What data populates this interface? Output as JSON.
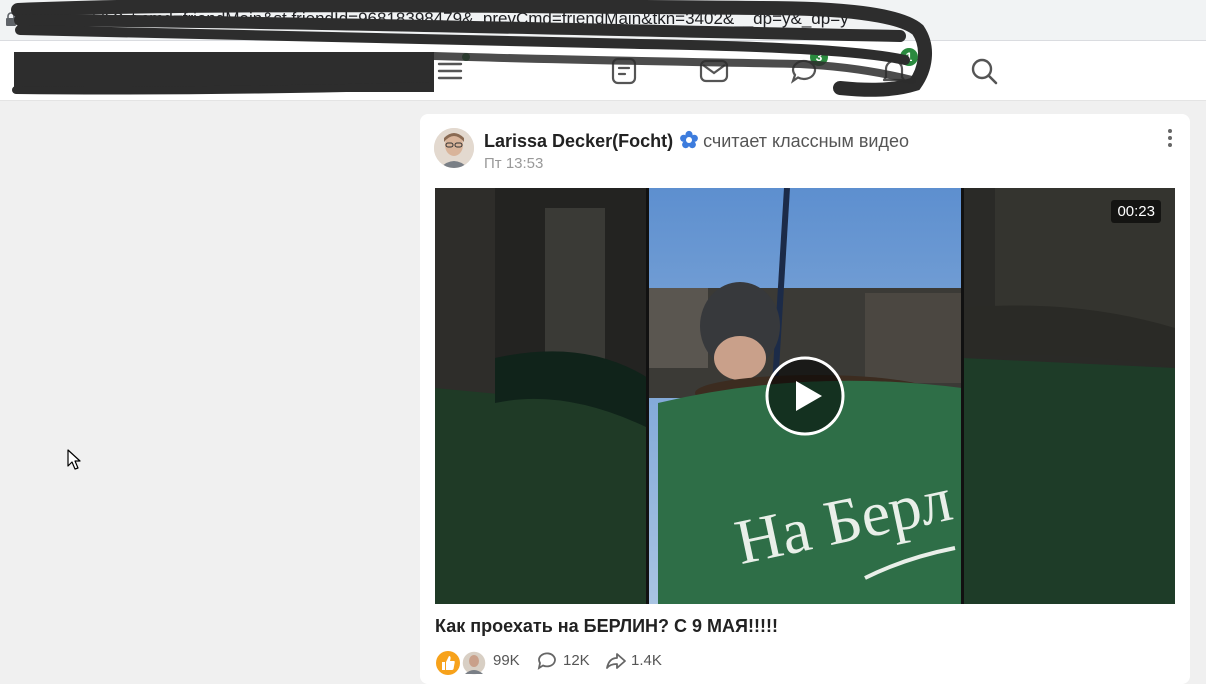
{
  "browser": {
    "url": "m.ok.ru/dk?st.cmd=friendMain&st.friendId=96818398479&_prevCmd=friendMain&tkn=3402&__dp=y&_dp=y"
  },
  "topnav": {
    "discussions_badge": "3",
    "notifications_badge": "1"
  },
  "post": {
    "author": "Larissa Decker(Focht)",
    "action": "считает классным видео",
    "time": "Пт 13:53",
    "video": {
      "duration": "00:23",
      "caption_text": "На Берл"
    },
    "title": "Как проехать на БЕРЛИН? С 9 МАЯ!!!!!",
    "likes": "99K",
    "comments": "12K",
    "shares": "1.4K"
  },
  "colors": {
    "accent": "#2a8a3e",
    "background": "#f0f0f0"
  },
  "icons": [
    "lock-icon",
    "menu-icon",
    "feed-icon",
    "mail-icon",
    "discussions-icon",
    "bell-icon",
    "search-icon",
    "flower-icon",
    "play-icon",
    "kebab-icon",
    "comment-icon",
    "share-icon",
    "like-icon"
  ]
}
